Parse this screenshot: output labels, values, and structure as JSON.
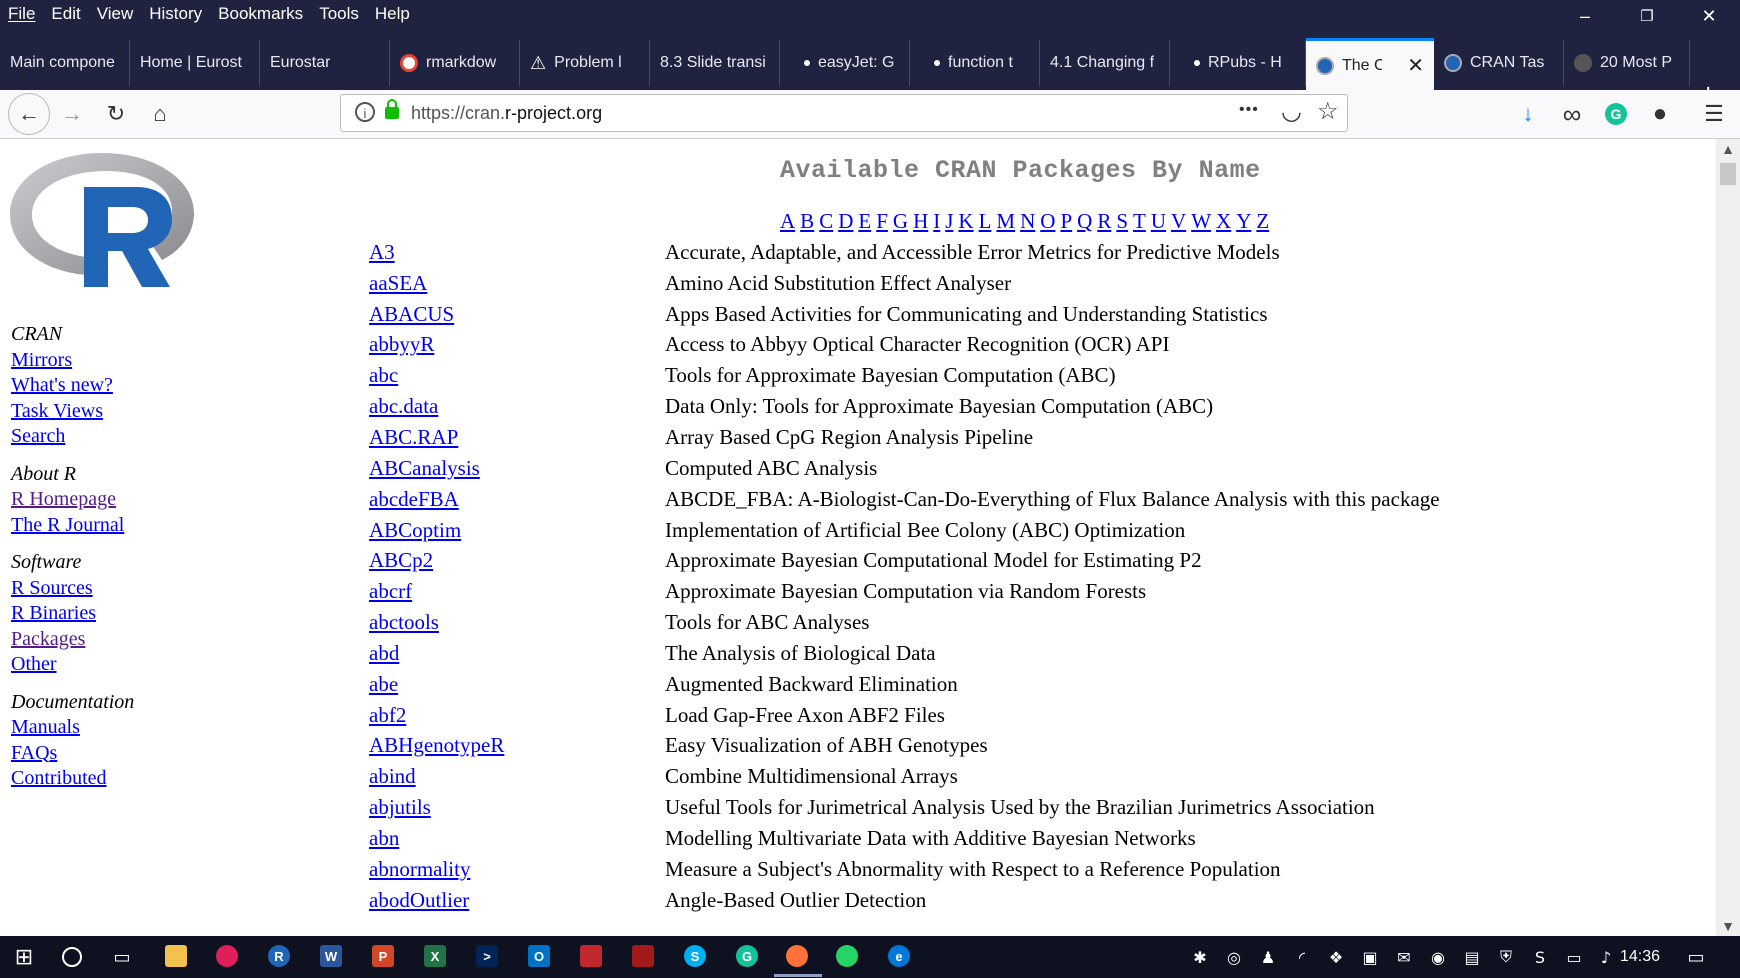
{
  "menu": [
    "File",
    "Edit",
    "View",
    "History",
    "Bookmarks",
    "Tools",
    "Help"
  ],
  "window_controls": {
    "minimize": "–",
    "restore": "❐",
    "close": "✕"
  },
  "tabs": [
    {
      "label": "Main compone",
      "active": false
    },
    {
      "label": "Home | Eurost",
      "active": false
    },
    {
      "label": "Eurostar",
      "active": false
    },
    {
      "label": "rmarkdow",
      "active": false
    },
    {
      "label": "Problem l",
      "active": false
    },
    {
      "label": "8.3 Slide transi",
      "active": false
    },
    {
      "label": "easyJet: G",
      "active": false
    },
    {
      "label": "function t",
      "active": false
    },
    {
      "label": "4.1 Changing f",
      "active": false
    },
    {
      "label": "RPubs - H",
      "active": false
    },
    {
      "label": "The Co",
      "active": true
    },
    {
      "label": "CRAN Tas",
      "active": false
    },
    {
      "label": "20 Most P",
      "active": false
    }
  ],
  "new_tab": "+",
  "tab_close": "✕",
  "nav": {
    "back": "←",
    "forward": "→",
    "reload": "↻",
    "home": "⌂"
  },
  "url": {
    "prefix": "https://cran.",
    "domain": "r-project.org"
  },
  "url_actions": {
    "more": "•••",
    "pocket": "◡",
    "bookmark": "☆"
  },
  "toolbar_right": {
    "download": "↓",
    "mask": "∞",
    "grammarly": "G",
    "account": "●",
    "menu": "☰"
  },
  "sidebar": {
    "groups": [
      {
        "header": "CRAN",
        "links": [
          {
            "label": "Mirrors",
            "visited": false
          },
          {
            "label": "What's new?",
            "visited": false
          },
          {
            "label": "Task Views",
            "visited": false
          },
          {
            "label": "Search",
            "visited": false
          }
        ]
      },
      {
        "header": "About R",
        "links": [
          {
            "label": "R Homepage",
            "visited": true
          },
          {
            "label": "The R Journal",
            "visited": false
          }
        ]
      },
      {
        "header": "Software",
        "links": [
          {
            "label": "R Sources",
            "visited": false
          },
          {
            "label": "R Binaries",
            "visited": false
          },
          {
            "label": "Packages",
            "visited": true
          },
          {
            "label": "Other",
            "visited": false
          }
        ]
      },
      {
        "header": "Documentation",
        "links": [
          {
            "label": "Manuals",
            "visited": false
          },
          {
            "label": "FAQs",
            "visited": false
          },
          {
            "label": "Contributed",
            "visited": false
          }
        ]
      }
    ]
  },
  "page_title": "Available CRAN Packages By Name",
  "alphabet": [
    "A",
    "B",
    "C",
    "D",
    "E",
    "F",
    "G",
    "H",
    "I",
    "J",
    "K",
    "L",
    "M",
    "N",
    "O",
    "P",
    "Q",
    "R",
    "S",
    "T",
    "U",
    "V",
    "W",
    "X",
    "Y",
    "Z"
  ],
  "packages": [
    {
      "name": "A3",
      "desc": "Accurate, Adaptable, and Accessible Error Metrics for Predictive Models"
    },
    {
      "name": "aaSEA",
      "desc": "Amino Acid Substitution Effect Analyser"
    },
    {
      "name": "ABACUS",
      "desc": "Apps Based Activities for Communicating and Understanding Statistics"
    },
    {
      "name": "abbyyR",
      "desc": "Access to Abbyy Optical Character Recognition (OCR) API"
    },
    {
      "name": "abc",
      "desc": "Tools for Approximate Bayesian Computation (ABC)"
    },
    {
      "name": "abc.data",
      "desc": "Data Only: Tools for Approximate Bayesian Computation (ABC)"
    },
    {
      "name": "ABC.RAP",
      "desc": "Array Based CpG Region Analysis Pipeline"
    },
    {
      "name": "ABCanalysis",
      "desc": "Computed ABC Analysis"
    },
    {
      "name": "abcdeFBA",
      "desc": "ABCDE_FBA: A-Biologist-Can-Do-Everything of Flux Balance Analysis with this package"
    },
    {
      "name": "ABCoptim",
      "desc": "Implementation of Artificial Bee Colony (ABC) Optimization"
    },
    {
      "name": "ABCp2",
      "desc": "Approximate Bayesian Computational Model for Estimating P2"
    },
    {
      "name": "abcrf",
      "desc": "Approximate Bayesian Computation via Random Forests"
    },
    {
      "name": "abctools",
      "desc": "Tools for ABC Analyses"
    },
    {
      "name": "abd",
      "desc": "The Analysis of Biological Data"
    },
    {
      "name": "abe",
      "desc": "Augmented Backward Elimination"
    },
    {
      "name": "abf2",
      "desc": "Load Gap-Free Axon ABF2 Files"
    },
    {
      "name": "ABHgenotypeR",
      "desc": "Easy Visualization of ABH Genotypes"
    },
    {
      "name": "abind",
      "desc": "Combine Multidimensional Arrays"
    },
    {
      "name": "abjutils",
      "desc": "Useful Tools for Jurimetrical Analysis Used by the Brazilian Jurimetrics Association"
    },
    {
      "name": "abn",
      "desc": "Modelling Multivariate Data with Additive Bayesian Networks"
    },
    {
      "name": "abnormality",
      "desc": "Measure a Subject's Abnormality with Respect to a Reference Population"
    },
    {
      "name": "abodOutlier",
      "desc": "Angle-Based Outlier Detection"
    }
  ],
  "taskbar": {
    "clock": "14:36"
  },
  "colors": {
    "chrome_dark": "#202340",
    "link": "#0000ee",
    "visited": "#551a8b",
    "title_gray": "#808080",
    "accent": "#0a84ff"
  }
}
